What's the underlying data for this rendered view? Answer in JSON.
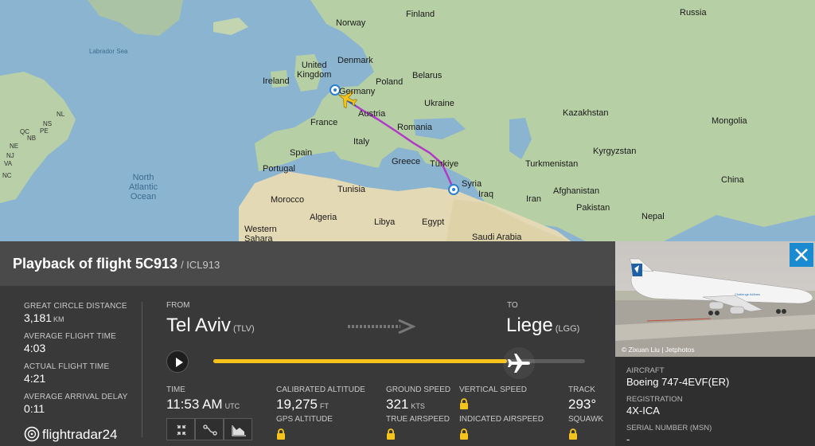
{
  "map": {
    "labels": {
      "finland": "Finland",
      "norway": "Norway",
      "russia": "Russia",
      "labrador_sea": "Labrador Sea",
      "united_kingdom": "United\nKingdom",
      "denmark": "Denmark",
      "ireland": "Ireland",
      "belarus": "Belarus",
      "poland": "Poland",
      "germany": "Germany",
      "ukraine": "Ukraine",
      "austria": "Austria",
      "france": "France",
      "kazakhstan": "Kazakhstan",
      "mongolia": "Mongolia",
      "romania": "Romania",
      "italy": "Italy",
      "spain": "Spain",
      "kyrgyzstan": "Kyrgyzstan",
      "greece": "Greece",
      "turkiye": "Türkiye",
      "turkmenistan": "Turkmenistan",
      "portugal": "Portugal",
      "north_atlantic_ocean": "North\nAtlantic\nOcean",
      "tunisia": "Tunisia",
      "syria": "Syria",
      "iraq": "Iraq",
      "afghanistan": "Afghanistan",
      "china": "China",
      "morocco": "Morocco",
      "iran": "Iran",
      "pakistan": "Pakistan",
      "algeria": "Algeria",
      "libya": "Libya",
      "egypt": "Egypt",
      "nepal": "Nepal",
      "western_sahara": "Western\nSahara",
      "saudi_arabia": "Saudi Arabia",
      "nl": "NL",
      "ns": "NS",
      "pe": "PE",
      "nb": "NB",
      "qc": "QC",
      "ne": "NE",
      "nj": "NJ",
      "va": "VA",
      "nc": "NC"
    }
  },
  "panel": {
    "title": "Playback of flight 5C913",
    "subtitle": "/ ICL913",
    "stats": [
      {
        "label": "GREAT CIRCLE DISTANCE",
        "value": "3,181",
        "unit": "KM"
      },
      {
        "label": "AVERAGE FLIGHT TIME",
        "value": "4:03",
        "unit": ""
      },
      {
        "label": "ACTUAL FLIGHT TIME",
        "value": "4:21",
        "unit": ""
      },
      {
        "label": "AVERAGE ARRIVAL DELAY",
        "value": "0:11",
        "unit": ""
      }
    ],
    "from_label": "FROM",
    "to_label": "TO",
    "from_city": "Tel Aviv",
    "from_code": "(TLV)",
    "to_city": "Liege",
    "to_code": "(LGG)",
    "progress": 0.79,
    "flight": {
      "time_label": "TIME",
      "time_value": "11:53 AM",
      "time_unit": "UTC",
      "cal_alt_label": "CALIBRATED ALTITUDE",
      "cal_alt_value": "19,275",
      "cal_alt_unit": "FT",
      "gps_alt_label": "GPS ALTITUDE",
      "ground_speed_label": "GROUND SPEED",
      "ground_speed_value": "321",
      "ground_speed_unit": "KTS",
      "true_airspeed_label": "TRUE AIRSPEED",
      "vertical_speed_label": "VERTICAL SPEED",
      "indicated_airspeed_label": "INDICATED AIRSPEED",
      "track_label": "TRACK",
      "track_value": "293°",
      "squawk_label": "SQUAWK"
    },
    "logo": "flightradar24",
    "colors": {
      "accent": "#f6c21c",
      "route": "#b03cc6",
      "close": "#1a8bd0"
    }
  },
  "aircraft": {
    "photo_credit": "© Zixuan Liu | Jetphotos",
    "aircraft_label": "AIRCRAFT",
    "aircraft_value": "Boeing 747-4EVF(ER)",
    "registration_label": "REGISTRATION",
    "registration_value": "4X-ICA",
    "serial_label": "SERIAL NUMBER (MSN)",
    "serial_value": "-"
  }
}
